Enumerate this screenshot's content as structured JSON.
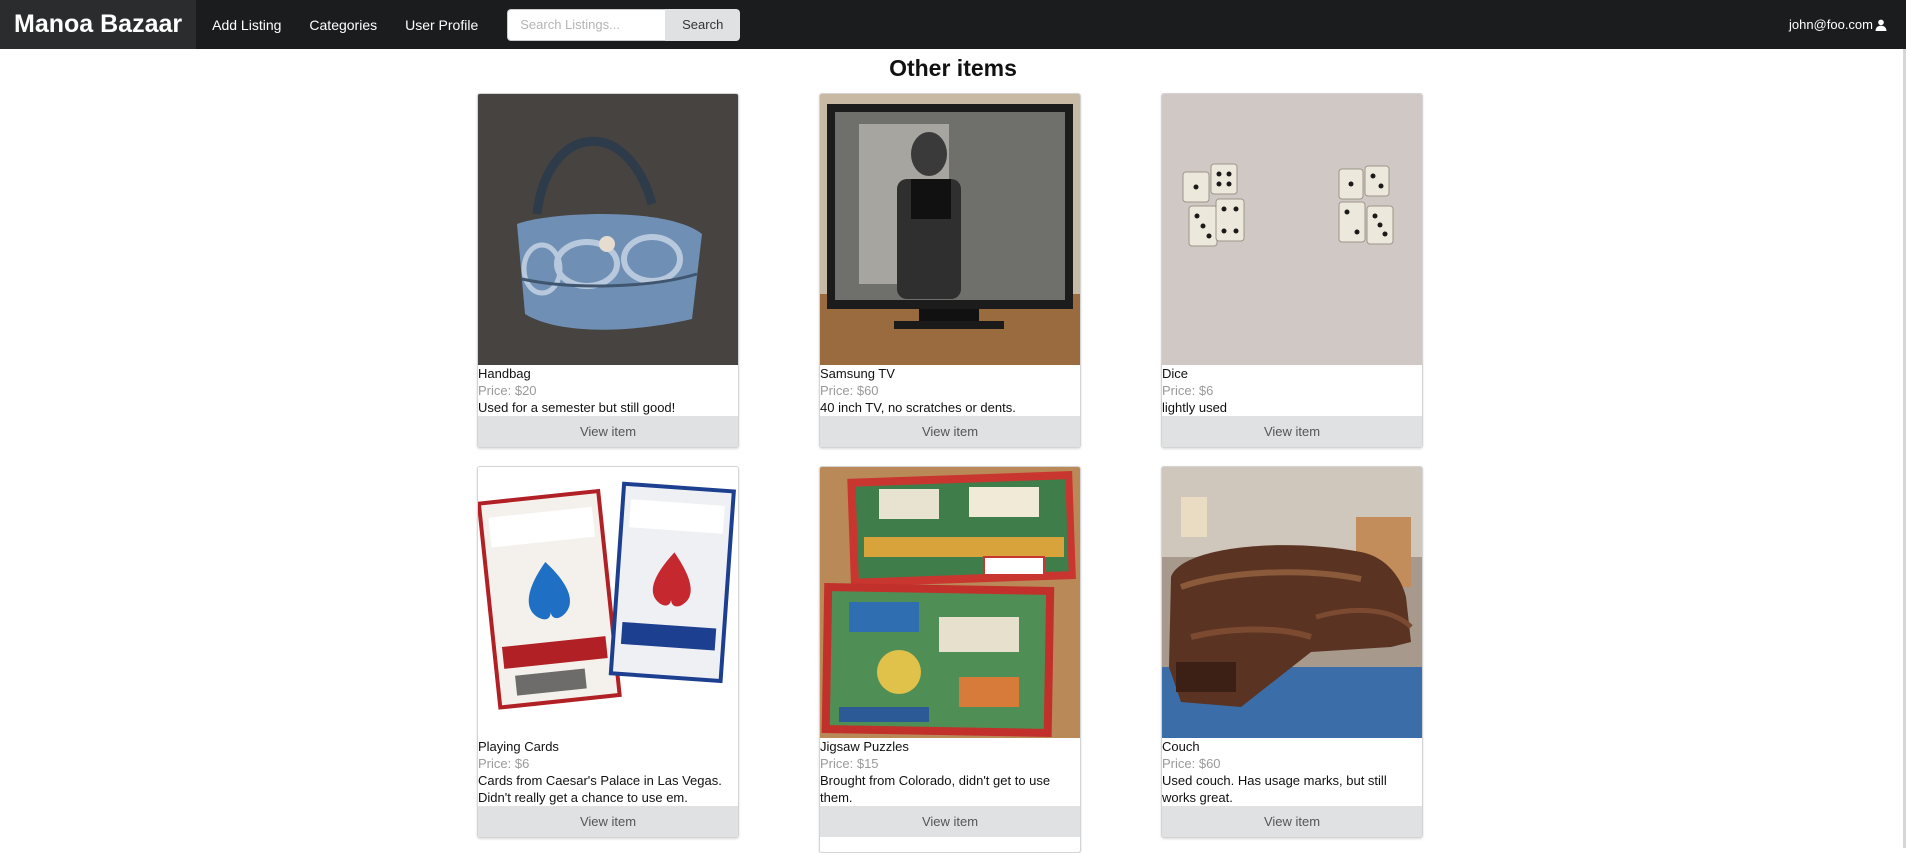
{
  "nav": {
    "brand": "Manoa Bazaar",
    "items": [
      {
        "label": "Add Listing"
      },
      {
        "label": "Categories"
      },
      {
        "label": "User Profile"
      }
    ],
    "search_placeholder": "Search Listings...",
    "search_button": "Search",
    "user_email": "john@foo.com"
  },
  "page": {
    "title": "Other items"
  },
  "cards": [
    {
      "title": "Handbag",
      "price": "Price: $20",
      "description": "Used for a semester but still good!",
      "button": "View item"
    },
    {
      "title": "Samsung TV",
      "price": "Price: $60",
      "description": "40 inch TV, no scratches or dents.",
      "button": "View item"
    },
    {
      "title": "Dice",
      "price": "Price: $6",
      "description": "lightly used",
      "button": "View item"
    },
    {
      "title": "Playing Cards",
      "price": "Price: $6",
      "description": "Cards from Caesar's Palace in Las Vegas. Didn't really get a chance to use em.",
      "button": "View item"
    },
    {
      "title": "Jigsaw Puzzles",
      "price": "Price: $15",
      "description": "Brought from Colorado, didn't get to use them.",
      "button": "View item"
    },
    {
      "title": "Couch",
      "price": "Price: $60",
      "description": "Used couch. Has usage marks, but still works great.",
      "button": "View item"
    }
  ]
}
